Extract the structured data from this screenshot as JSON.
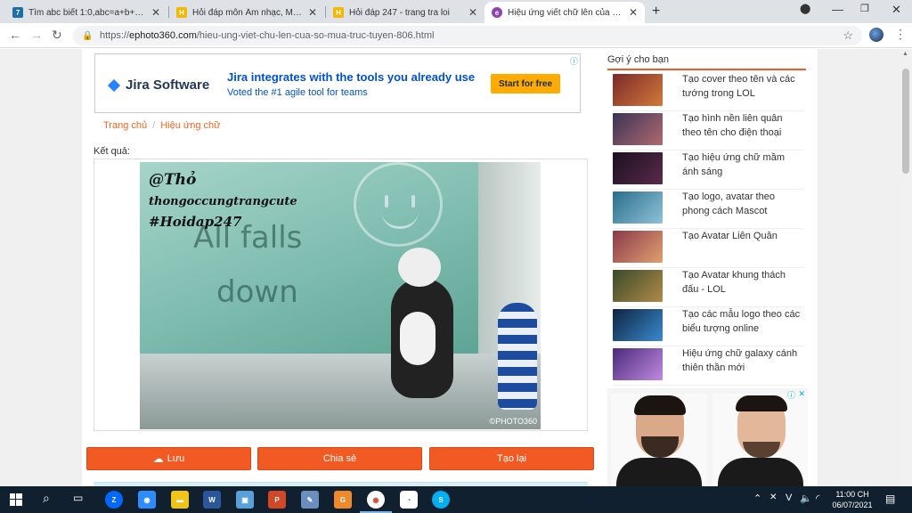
{
  "browser": {
    "tabs": [
      {
        "label": "Tìm abc biết 1:0,abc=a+b+c - Ar",
        "icon": "app-7-icon",
        "color": "#1d6fa5",
        "active": false
      },
      {
        "label": "Hỏi đáp môn Âm nhạc, Mỹ thuật",
        "icon": "hoidap-icon",
        "color": "#f5b800",
        "active": false
      },
      {
        "label": "Hỏi đáp 247 - trang tra loi",
        "icon": "hoidap-icon",
        "color": "#f5b800",
        "active": false
      },
      {
        "label": "Hiệu ứng viết chữ lên của sổ mư",
        "icon": "ephoto-icon",
        "color": "#8e44ad",
        "active": true
      }
    ],
    "url_prefix": "https://",
    "url_domain": "ephoto360.com",
    "url_path": "/hieu-ung-viet-chu-len-cua-so-mua-truc-tuyen-806.html"
  },
  "ad_jira": {
    "logo": "Jira Software",
    "headline": "Jira integrates with the tools you already use",
    "subline": "Voted the #1 agile tool for teams",
    "cta": "Start for free"
  },
  "breadcrumb": {
    "home": "Trang chủ",
    "separator": "/",
    "current": "Hiệu ứng chữ"
  },
  "result": {
    "label": "Kết quả:",
    "overlay_line1": "@Thỏ",
    "overlay_line2": "thongoccungtrangcute",
    "overlay_line3": "#Hoidap247",
    "frost_line1": "All falls",
    "frost_line2": "down",
    "watermark": "©PHOTO360"
  },
  "actions": {
    "save": "Lưu",
    "share": "Chia sẻ",
    "redo": "Tạo lại"
  },
  "sidebar": {
    "title": "Gợi ý cho bạn",
    "items": [
      {
        "label": "Tạo cover theo tên và các tướng trong LOL",
        "thumb": "#7a2a2a"
      },
      {
        "label": "Tạo hình nền liên quân theo tên cho điện thoại",
        "thumb": "#3b3355"
      },
      {
        "label": "Tạo hiệu ứng chữ mầm ánh sáng",
        "thumb": "#1a1020"
      },
      {
        "label": "Tạo logo, avatar theo phong cách Mascot",
        "thumb": "#2a6d8a"
      },
      {
        "label": "Tạo Avatar Liên Quân",
        "thumb": "#8a3a4a"
      },
      {
        "label": "Tạo Avatar khung thách đấu - LOL",
        "thumb": "#3a4a2a"
      },
      {
        "label": "Tạo các mẫu logo theo các biểu tượng online",
        "thumb": "#0e2340"
      },
      {
        "label": "Hiệu ứng chữ galaxy cánh thiên thần mới",
        "thumb": "#4a2a7a"
      }
    ]
  },
  "taskbar": {
    "apps": [
      "Zalo",
      "Zoom",
      "File Explorer",
      "Word",
      "Photos",
      "PowerPoint",
      "Paint",
      "Snip",
      "Chrome",
      "Vivaldi",
      "Skype"
    ],
    "time": "11:00 CH",
    "date": "06/07/2021",
    "lang": "V"
  }
}
